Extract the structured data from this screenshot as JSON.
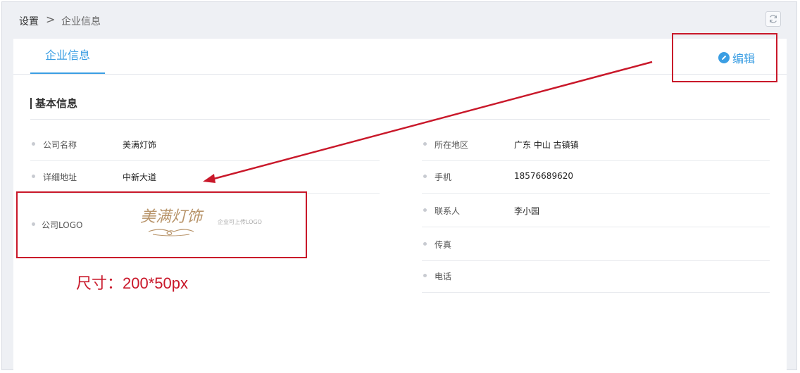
{
  "breadcrumb": {
    "root": "设置",
    "separator": ">",
    "current": "企业信息"
  },
  "tabs": [
    {
      "label": "企业信息",
      "active": true
    }
  ],
  "edit_label": "编辑",
  "section_title": "基本信息",
  "left_fields": [
    {
      "label": "公司名称",
      "value": "美满灯饰"
    },
    {
      "label": "详细地址",
      "value": "中新大道"
    }
  ],
  "logo_field": {
    "label": "公司LOGO",
    "logo_text": "美满灯饰",
    "hint": "企业可上传LOGO"
  },
  "right_fields": [
    {
      "label": "所在地区",
      "value": "广东 中山 古镇镇"
    },
    {
      "label": "手机",
      "value": "18576689620"
    },
    {
      "label": "联系人",
      "value": "李小园"
    },
    {
      "label": "传真",
      "value": ""
    },
    {
      "label": "电话",
      "value": ""
    }
  ],
  "annotation": {
    "text": "尺寸：200*50px",
    "color": "#c9182a"
  },
  "colors": {
    "accent": "#3b9ee3",
    "annotation": "#c9182a",
    "background": "#eef0f4"
  },
  "icons": {
    "refresh": "refresh-icon",
    "edit": "pencil-circle-icon"
  }
}
